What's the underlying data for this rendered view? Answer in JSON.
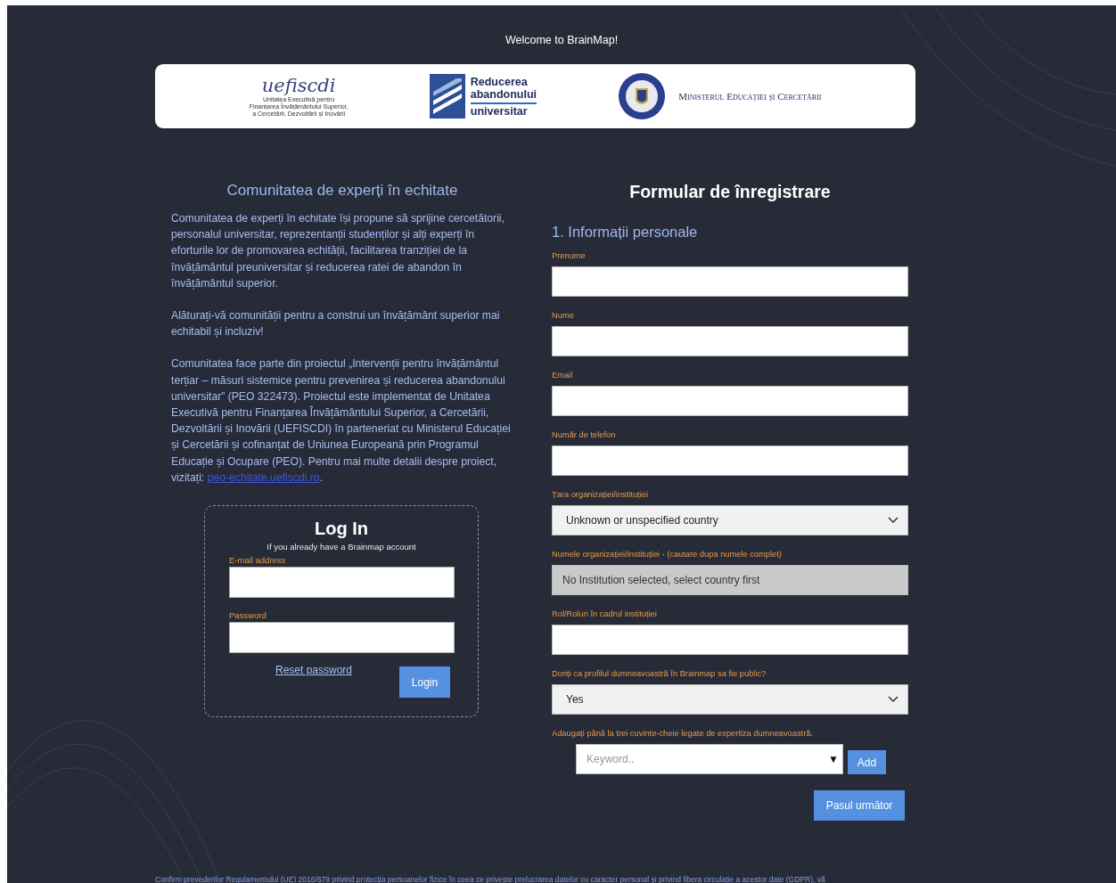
{
  "header": {
    "welcome": "Welcome to BrainMap!"
  },
  "logos": [
    {
      "kind": "uefiscdi",
      "name": "uefiscdi",
      "lines": [
        "Unitatea Executivă pentru",
        "Finanțarea Învățământului Superior,",
        "a Cercetării, Dezvoltării și Inovării"
      ]
    },
    {
      "kind": "reducerea",
      "lines": [
        "Reducerea",
        "abandonului",
        "universitar"
      ]
    },
    {
      "kind": "ministry",
      "name": "Ministerul Educației și Cercetării"
    }
  ],
  "about": {
    "title": "Comunitatea de experți în echitate",
    "paragraphs": [
      "Comunitatea de experți în echitate își propune să sprijine cercetătorii, personalul universitar, reprezentanții studenților și alți experți în eforturile lor de promovarea echității, facilitarea tranziției de la învățământul preuniversitar și reducerea ratei de abandon în învățământul superior.",
      "Alăturați-vă comunității pentru a construi un învățământ superior mai echitabil și incluziv!",
      "Comunitatea face parte din proiectul „Intervenții pentru învățământul terțiar – măsuri sistemice pentru prevenirea și reducerea abandonului universitar” (PEO 322473). Proiectul este implementat de Unitatea Executivă pentru Finanțarea Învățământului Superior, a Cercetării, Dezvoltării și Inovării (UEFISCDI) în parteneriat cu Ministerul Educației și Cercetării și cofinanțat de Uniunea Europeană prin Programul Educație și Ocupare (PEO). Pentru mai multe detalii despre proiect, vizitați:"
    ],
    "link": "peo-echitate.uefiscdi.ro",
    "link_after": "."
  },
  "login": {
    "title": "Log In",
    "subtitle": "If you already have a Brainmap account",
    "fields": [
      {
        "label": "E-mail address"
      },
      {
        "label": "Password"
      }
    ],
    "reset": "Reset password",
    "button": "Login"
  },
  "form": {
    "title": "Formular de înregistrare",
    "section": "1. Informații personale",
    "fields": [
      {
        "label": "Prenume",
        "kind": "text"
      },
      {
        "label": "Nume",
        "kind": "text"
      },
      {
        "label": "Email",
        "kind": "text"
      },
      {
        "label": "Număr de telefon",
        "kind": "text"
      },
      {
        "label": "Țara organizației/instituției",
        "kind": "select",
        "value": "Unknown or unspecified country"
      },
      {
        "label": "Numele organizației/instituției - (cautare dupa numele complet)",
        "kind": "disabled",
        "value": "No Institution selected, select country first"
      },
      {
        "label": "Rol/Roluri în cadrul instituției",
        "kind": "text"
      },
      {
        "label": "Doriți ca profilul dumneavoastră în Brainmap sa fie public?",
        "kind": "select",
        "value": "Yes"
      },
      {
        "label": "Adaugați până la trei cuvinte-cheie legate de expertiza dumneavoastră.",
        "kind": "keyword",
        "placeholder": "Keyword..",
        "arrow": "▼",
        "button": "Add"
      }
    ],
    "next": "Pasul următor"
  },
  "footer": "Confirm prevederilor Regulamentului (UE) 2016/679 privind protecția persoanelor fizice în ceea ce privește prelucrarea datelor cu caracter personal și privind libera circulație a acestor date (GDPR), vă"
}
